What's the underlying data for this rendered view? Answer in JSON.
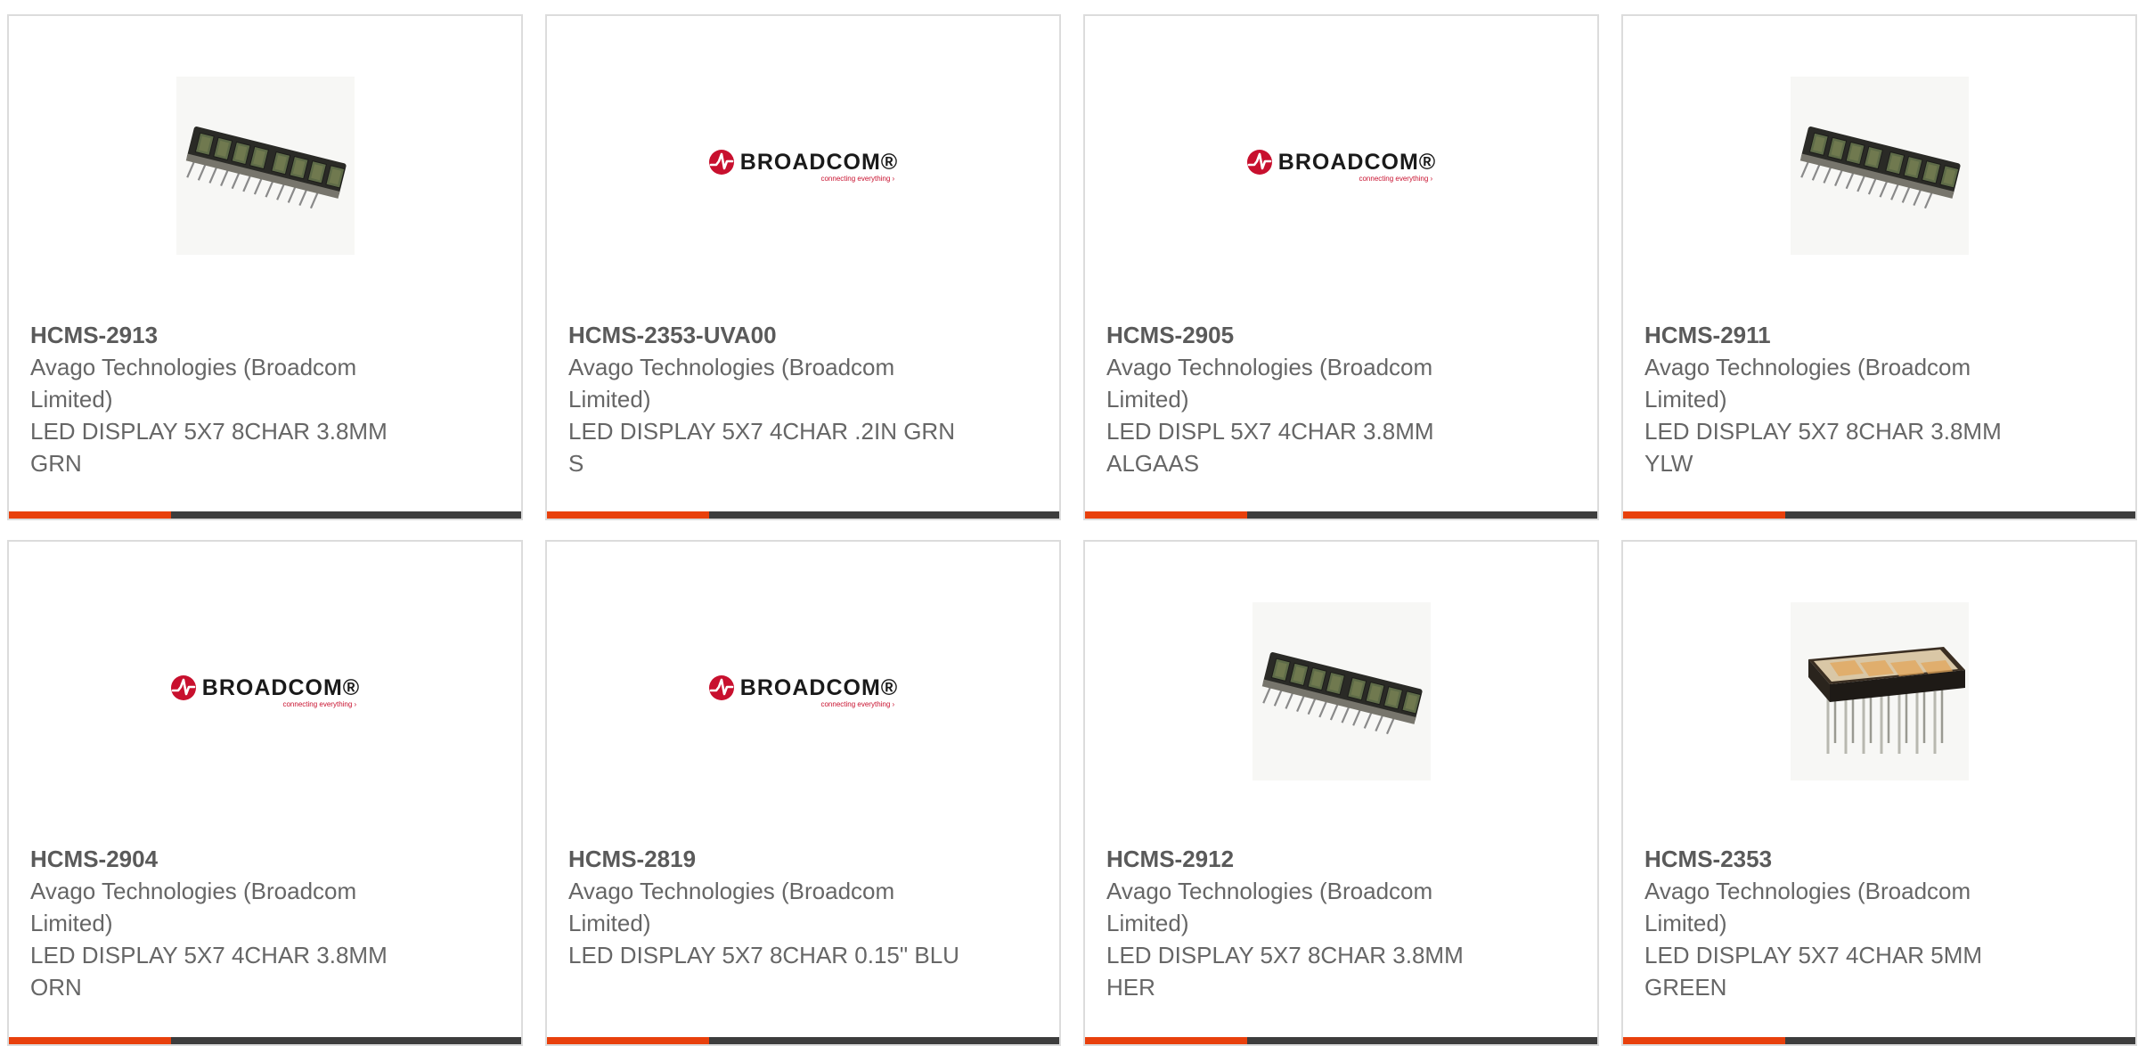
{
  "products": [
    {
      "part_number": "HCMS-2913",
      "manufacturer": "Avago Technologies (Broadcom Limited)",
      "description": "LED DISPLAY 5X7 8CHAR 3.8MM GRN",
      "image": "led-bar-display-photo"
    },
    {
      "part_number": "HCMS-2353-UVA00",
      "manufacturer": "Avago Technologies (Broadcom Limited)",
      "description": "LED DISPLAY 5X7 4CHAR .2IN GRN S",
      "image": "broadcom-logo"
    },
    {
      "part_number": "HCMS-2905",
      "manufacturer": "Avago Technologies (Broadcom Limited)",
      "description": "LED DISPL 5X7 4CHAR 3.8MM ALGAAS",
      "image": "broadcom-logo"
    },
    {
      "part_number": "HCMS-2911",
      "manufacturer": "Avago Technologies (Broadcom Limited)",
      "description": "LED DISPLAY 5X7 8CHAR 3.8MM YLW",
      "image": "led-bar-display-photo"
    },
    {
      "part_number": "HCMS-2904",
      "manufacturer": "Avago Technologies (Broadcom Limited)",
      "description": "LED DISPLAY 5X7 4CHAR 3.8MM ORN",
      "image": "broadcom-logo"
    },
    {
      "part_number": "HCMS-2819",
      "manufacturer": "Avago Technologies (Broadcom Limited)",
      "description": "LED DISPLAY 5X7 8CHAR 0.15\" BLU",
      "image": "broadcom-logo"
    },
    {
      "part_number": "HCMS-2912",
      "manufacturer": "Avago Technologies (Broadcom Limited)",
      "description": "LED DISPLAY 5X7 8CHAR 3.8MM HER",
      "image": "led-bar-display-photo"
    },
    {
      "part_number": "HCMS-2353",
      "manufacturer": "Avago Technologies (Broadcom Limited)",
      "description": "LED DISPLAY 5X7 4CHAR 5MM GREEN",
      "image": "dip-led-display-photo"
    }
  ],
  "logo": {
    "wordmark": "BROADCOM",
    "trademark": "®",
    "tagline": "connecting everything"
  },
  "colors": {
    "accent": "#e8400c",
    "bar": "#3d3d3d",
    "border": "#dcdcdc",
    "text": "#666666",
    "logo_red": "#c8102e"
  }
}
